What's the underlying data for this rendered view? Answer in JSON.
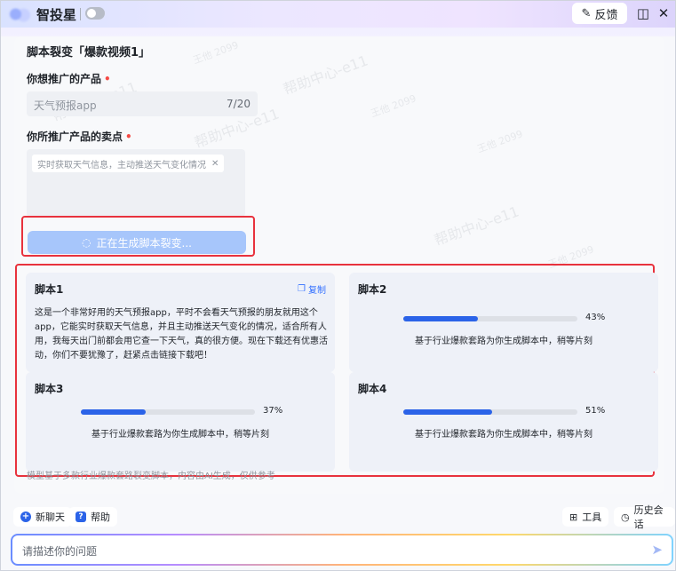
{
  "titlebar": {
    "app_name": "智投星",
    "feedback_label": "反馈",
    "feedback_icon": "edit-icon",
    "sidebar_icon": "sidebar-icon",
    "close_icon": "close-icon"
  },
  "form": {
    "page_title": "脚本裂变「爆款视频1」",
    "product_label": "你想推广的产品",
    "product_value": "天气预报app",
    "product_count": "7/20",
    "selling_points_label": "你所推广产品的卖点",
    "selling_point_tag": "实时获取天气信息，主动推送天气变化情况",
    "generate_label": "正在生成脚本裂变..."
  },
  "scripts": [
    {
      "title": "脚本1",
      "copy_label": "复制",
      "body": "这是一个非常好用的天气预报app，平时不会看天气预报的朋友就用这个app，它能实时获取天气信息，并且主动推送天气变化的情况，适合所有人用，我每天出门前都会用它查一下天气，真的很方便。现在下载还有优惠活动，你们不要犹豫了，赶紧点击链接下载吧！"
    },
    {
      "title": "脚本2",
      "progress": 0.43,
      "progress_label": "43%",
      "note": "基于行业爆款套路为你生成脚本中，稍等片刻"
    },
    {
      "title": "脚本3",
      "progress": 0.37,
      "progress_label": "37%",
      "note": "基于行业爆款套路为你生成脚本中，稍等片刻"
    },
    {
      "title": "脚本4",
      "progress": 0.51,
      "progress_label": "51%",
      "note": "基于行业爆款套路为你生成脚本中，稍等片刻"
    }
  ],
  "disclaimer": "模型基于多款行业爆款套路裂变脚本，内容由AI生成，仅供参考",
  "bottom": {
    "new_chat_label": "新聊天",
    "help_label": "帮助",
    "tools_label": "工具",
    "history_label": "历史会话",
    "input_placeholder": "请描述你的问题"
  },
  "colors": {
    "accent": "#2b63e8",
    "highlight_border": "#e8323d",
    "generate_button": "#a7c6fb",
    "required_mark": "#f54a45"
  }
}
